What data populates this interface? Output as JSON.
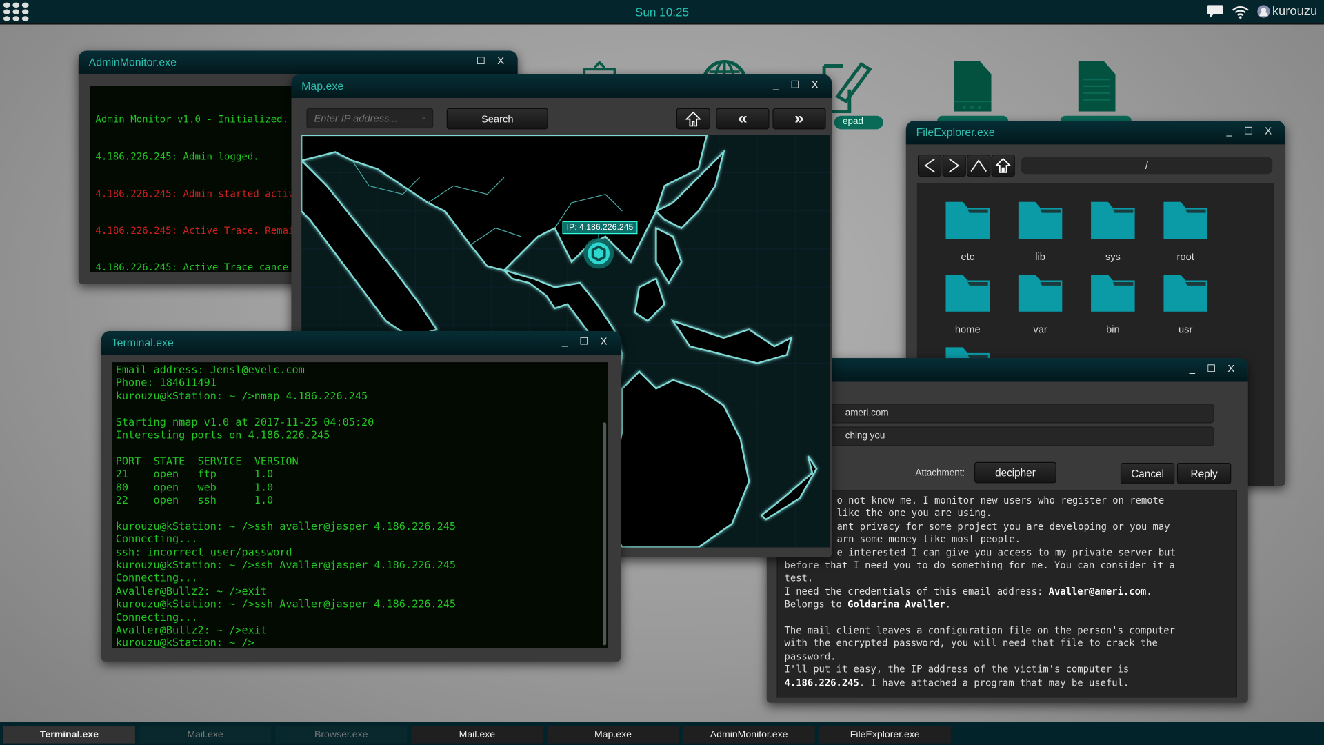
{
  "topbar": {
    "clock": "Sun 10:25",
    "user": "kurouzu",
    "icons": [
      "apps-grid-icon",
      "chat-icon",
      "wifi-icon",
      "user-avatar-icon"
    ]
  },
  "desktop": {
    "icons": [
      {
        "icon": "clipboard-icon"
      },
      {
        "icon": "globe-icon"
      },
      {
        "icon": "notepad-icon",
        "label": "epad"
      },
      {
        "icon": "server-file-icon"
      },
      {
        "icon": "document-icon"
      }
    ]
  },
  "admin": {
    "title": "AdminMonitor.exe",
    "lines": [
      {
        "text": "Admin Monitor v1.0 - Initialized.",
        "color": "green"
      },
      {
        "text": "4.186.226.245: Admin logged.",
        "color": "green"
      },
      {
        "text": "4.186.226.245: Admin started activ",
        "color": "red"
      },
      {
        "text": "4.186.226.245: Active Trace. Remai",
        "color": "red"
      },
      {
        "text": "4.186.226.245: Active Trace cance",
        "color": "green"
      }
    ]
  },
  "map": {
    "title": "Map.exe",
    "ip_placeholder": "Enter IP address...",
    "search_label": "Search",
    "marker_label": "IP: 4.186.226.245",
    "accent": "#2ed6d0"
  },
  "terminal": {
    "title": "Terminal.exe",
    "lines": [
      "Email address: Jensl@evelc.com",
      "Phone: 184611491",
      "kurouzu@kStation: ~ />nmap 4.186.226.245",
      "",
      "Starting nmap v1.0 at 2017-11-25 04:05:20",
      "Interesting ports on 4.186.226.245",
      "",
      "PORT  STATE  SERVICE  VERSION",
      "21    open   ftp      1.0",
      "80    open   web      1.0",
      "22    open   ssh      1.0",
      "",
      "kurouzu@kStation: ~ />ssh avaller@jasper 4.186.226.245",
      "Connecting...",
      "ssh: incorrect user/password",
      "kurouzu@kStation: ~ />ssh Avaller@jasper 4.186.226.245",
      "Connecting...",
      "Avaller@Bullz2: ~ />exit",
      "kurouzu@kStation: ~ />ssh Avaller@jasper 4.186.226.245",
      "Connecting...",
      "Avaller@Bullz2: ~ />exit",
      "kurouzu@kStation: ~ />"
    ]
  },
  "explorer": {
    "title": "FileExplorer.exe",
    "path": "/",
    "folders": [
      "etc",
      "lib",
      "sys",
      "root",
      "home",
      "var",
      "bin",
      "usr"
    ],
    "folder_color": "#0a9ba6"
  },
  "mail": {
    "from_value": "ameri.com",
    "subject_value": "ching you",
    "attachment_label": "Attachment:",
    "attachment": "decipher",
    "cancel": "Cancel",
    "reply": "Reply",
    "partial_lines": [
      "o not know me. I monitor new users who register on remote",
      "like the one you are using.",
      "ant privacy for some project you are developing or you may",
      "arn some money like most people.",
      "e interested I can give you access to my private server but"
    ],
    "line6": "before that I need you to do something for me. You can consider it a",
    "line7": "test.",
    "line8a": "I need the credentials of this email address: ",
    "line8b": "Avaller@ameri.com",
    "line8c": ".",
    "line9a": "Belongs to ",
    "line9b": "Goldarina Avaller",
    "line9c": ".",
    "line11": "The mail client leaves a configuration file on the person's computer",
    "line12": "with the encrypted password, you will need that file to crack the",
    "line13": "password.",
    "line14": "I'll put it easy, the IP address of the victim's computer is",
    "line15a": "4.186.226.245",
    "line15b": ". I have attached a program that may be useful."
  },
  "taskbar": [
    {
      "label": "Terminal.exe",
      "state": "active"
    },
    {
      "label": "Mail.exe",
      "state": "dim"
    },
    {
      "label": "Browser.exe",
      "state": "dim"
    },
    {
      "label": "Mail.exe",
      "state": "normal"
    },
    {
      "label": "Map.exe",
      "state": "normal"
    },
    {
      "label": "AdminMonitor.exe",
      "state": "normal"
    },
    {
      "label": "FileExplorer.exe",
      "state": "normal"
    }
  ]
}
